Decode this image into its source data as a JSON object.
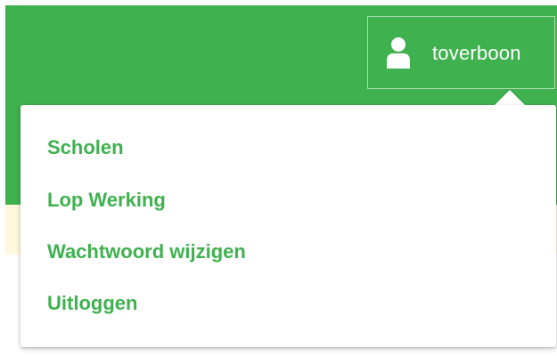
{
  "header": {
    "user": {
      "icon": "user-icon",
      "name": "toverboon"
    }
  },
  "dropdown": {
    "items": [
      {
        "label": "Scholen"
      },
      {
        "label": "Lop Werking"
      },
      {
        "label": "Wachtwoord wijzigen"
      },
      {
        "label": "Uitloggen"
      }
    ]
  },
  "colors": {
    "brand_green": "#3fb14f",
    "pale_yellow": "#fff8de",
    "white": "#ffffff"
  }
}
